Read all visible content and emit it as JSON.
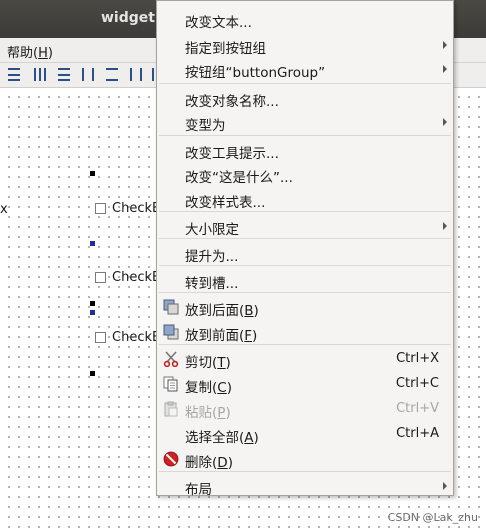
{
  "window": {
    "title": "widget."
  },
  "menubar": {
    "help_label": "帮助(",
    "help_key": "H",
    "help_close": ")"
  },
  "canvas": {
    "checkbox_left_partial": "x",
    "checkbox_1": "CheckB",
    "checkbox_2": "CheckB",
    "checkbox_3": "CheckB"
  },
  "context_menu": {
    "items": [
      {
        "label": "改变文本...",
        "submenu": false
      },
      {
        "label": "指定到按钮组",
        "submenu": true
      },
      {
        "label": "按钮组“buttonGroup”",
        "submenu": true
      },
      {
        "label": "改变对象名称...",
        "submenu": false
      },
      {
        "label": "变型为",
        "submenu": true
      },
      {
        "label": "改变工具提示...",
        "submenu": false
      },
      {
        "label": "改变“这是什么”...",
        "submenu": false
      },
      {
        "label": "改变样式表...",
        "submenu": false
      },
      {
        "label": "大小限定",
        "submenu": true
      },
      {
        "label": "提升为...",
        "submenu": false
      },
      {
        "label": "转到槽...",
        "submenu": false
      },
      {
        "label": "放到后面(",
        "key": "B",
        "close": ")",
        "icon": "send-to-back-icon"
      },
      {
        "label": "放到前面(",
        "key": "F",
        "close": ")",
        "icon": "bring-to-front-icon"
      },
      {
        "label": "剪切(",
        "key": "T",
        "close": ")",
        "shortcut": "Ctrl+X",
        "icon": "scissors-icon"
      },
      {
        "label": "复制(",
        "key": "C",
        "close": ")",
        "shortcut": "Ctrl+C",
        "icon": "copy-icon"
      },
      {
        "label": "粘贴(",
        "key": "P",
        "close": ")",
        "shortcut": "Ctrl+V",
        "icon": "paste-icon",
        "disabled": true
      },
      {
        "label": "选择全部(",
        "key": "A",
        "close": ")",
        "shortcut": "Ctrl+A"
      },
      {
        "label": "删除(",
        "key": "D",
        "close": ")",
        "icon": "delete-icon"
      },
      {
        "label": "布局",
        "submenu": true
      }
    ]
  },
  "watermark": "CSDN @Lak_zhu",
  "colors": {
    "menu_bg": "#f5f4f2",
    "titlebar_bg": "#3c3b37",
    "delete_red": "#d02020"
  }
}
